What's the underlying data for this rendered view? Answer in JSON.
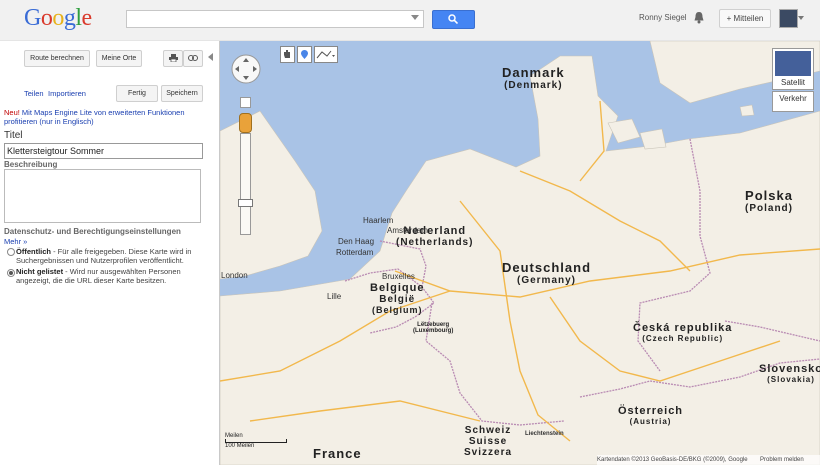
{
  "header": {
    "logo": "Google",
    "user_name": "Ronny Siegel",
    "share_label": "+ Mitteilen"
  },
  "panel": {
    "route_button": "Route berechnen",
    "my_places_button": "Meine Orte",
    "share_link": "Teilen",
    "import_link": "Importieren",
    "done_button": "Fertig",
    "save_button": "Speichern",
    "notice_new": "Neu!",
    "notice_text": " Mit Maps Engine Lite von erweiterten Funktionen profitieren (nur in Englisch)",
    "title_label": "Titel",
    "title_value": "Klettersteigtour Sommer",
    "description_label": "Beschreibung",
    "privacy_label": "Datenschutz- und Berechtigungseinstellungen",
    "more_link": "Mehr »",
    "option_public_title": "Öffentlich",
    "option_public_text": " - Für alle freigegeben. Diese Karte wird in Suchergebnissen und Nutzerprofilen veröffentlicht.",
    "option_unlisted_title": "Nicht gelistet",
    "option_unlisted_text": " - Wird nur ausgewählten Personen angezeigt, die die URL dieser Karte besitzen.",
    "selected_option": "Nicht gelistet"
  },
  "map": {
    "satellite_label": "Satellit",
    "traffic_label": "Verkehr",
    "scale_top": "Meilen",
    "scale_bottom": "100 Meilen",
    "footer": "Kartendaten ©2013 GeoBasis-DE/BKG (©2009), Google",
    "report_problem": "Problem melden",
    "countries": {
      "denmark": "Danmark",
      "denmark_sub": "(Denmark)",
      "netherlands": "Nederland",
      "netherlands_sub": "(Netherlands)",
      "belgium": "Belgique",
      "belgium_2": "België",
      "belgium_sub": "(Belgium)",
      "germany": "Deutschland",
      "germany_sub": "(Germany)",
      "poland": "Polska",
      "poland_sub": "(Poland)",
      "czech": "Česká republika",
      "czech_sub": "(Czech Republic)",
      "austria": "Österreich",
      "austria_sub": "(Austria)",
      "slovakia": "Slovensko",
      "slovakia_sub": "(Slovakia)",
      "switzerland": "Schweiz",
      "switzerland_2": "Suisse",
      "switzerland_3": "Svizzera",
      "france": "France",
      "luxembourg": "Lëtzebuerg",
      "luxembourg_sub": "(Luxembourg)",
      "liechtenstein": "Liechtenstein"
    },
    "cities": {
      "haarlem": "Haarlem",
      "amsterdam": "Amsterdam",
      "den_haag": "Den Haag",
      "rotterdam": "Rotterdam",
      "london": "London",
      "lille": "Lille",
      "bruxelles": "Bruxelles"
    }
  },
  "colors": {
    "water": "#a9c3e6",
    "land": "#f3efe6",
    "accent": "#4585f3",
    "link": "#1a3fb0",
    "notice_new": "#c00000"
  }
}
